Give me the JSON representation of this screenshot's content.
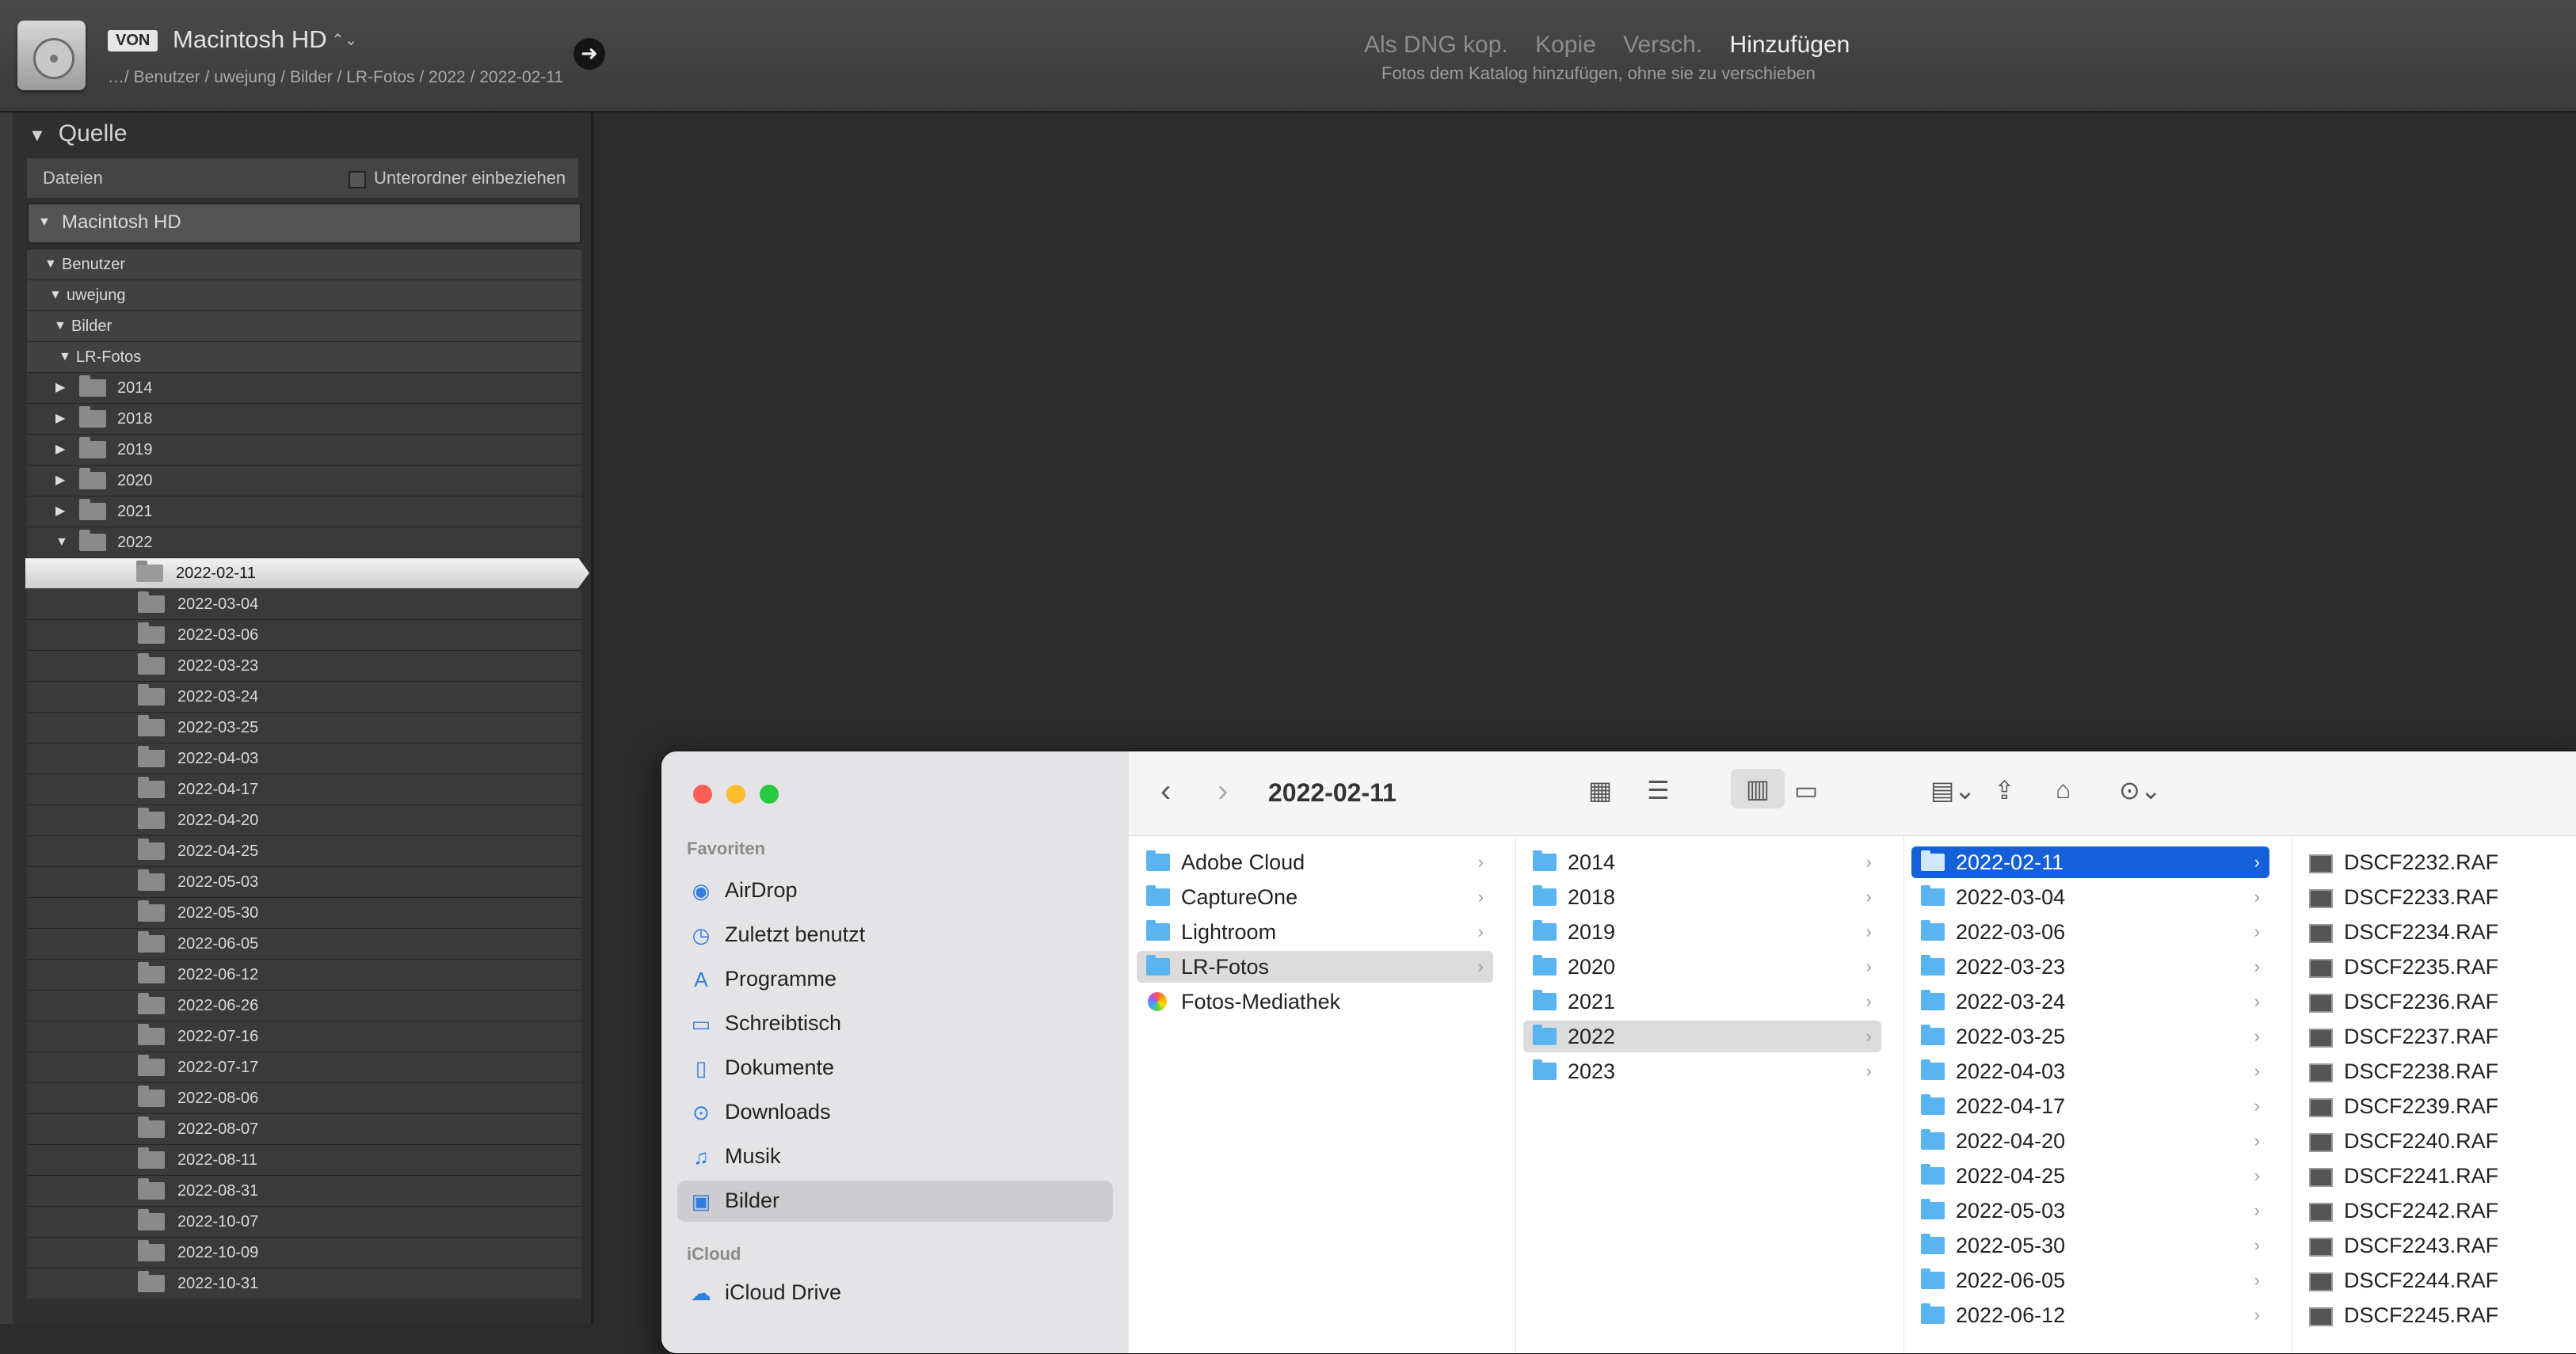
{
  "topbar": {
    "von_badge": "VON",
    "source": "Macintosh HD",
    "source_arrows": "⌃⌄",
    "breadcrumb": "…/ Benutzer / uwejung / Bilder / LR-Fotos / 2022 / 2022-02-11",
    "modes": [
      "Als DNG kop.",
      "Kopie",
      "Versch.",
      "Hinzufügen"
    ],
    "active_mode": "Hinzufügen",
    "mode_description": "Fotos dem Katalog hinzufügen, ohne sie zu verschieben"
  },
  "source_panel": {
    "title": "Quelle",
    "files_label": "Dateien",
    "subfolder_label": "Unterordner einbeziehen",
    "subfolder_checked": false,
    "volume": "Macintosh HD",
    "path": [
      "Benutzer",
      "uwejung",
      "Bilder",
      "LR-Fotos"
    ],
    "year_folders": [
      "2014",
      "2018",
      "2019",
      "2020",
      "2021",
      "2022"
    ],
    "expanded_year": "2022",
    "subfolders": [
      "2022-02-11",
      "2022-03-04",
      "2022-03-06",
      "2022-03-23",
      "2022-03-24",
      "2022-03-25",
      "2022-04-03",
      "2022-04-17",
      "2022-04-20",
      "2022-04-25",
      "2022-05-03",
      "2022-05-30",
      "2022-06-05",
      "2022-06-12",
      "2022-06-26",
      "2022-07-16",
      "2022-07-17",
      "2022-08-06",
      "2022-08-07",
      "2022-08-11",
      "2022-08-31",
      "2022-10-07",
      "2022-10-09",
      "2022-10-31"
    ],
    "selected_folder": "2022-02-11"
  },
  "finder": {
    "title": "2022-02-11",
    "sidebar": {
      "favorites_header": "Favoriten",
      "favorites": [
        {
          "label": "AirDrop",
          "icon": "airdrop-icon"
        },
        {
          "label": "Zuletzt benutzt",
          "icon": "clock-icon"
        },
        {
          "label": "Programme",
          "icon": "apps-icon"
        },
        {
          "label": "Schreibtisch",
          "icon": "desktop-icon"
        },
        {
          "label": "Dokumente",
          "icon": "document-icon"
        },
        {
          "label": "Downloads",
          "icon": "download-icon"
        },
        {
          "label": "Musik",
          "icon": "music-icon"
        },
        {
          "label": "Bilder",
          "icon": "photo-icon"
        }
      ],
      "selected": "Bilder",
      "icloud_header": "iCloud",
      "icloud": [
        {
          "label": "iCloud Drive",
          "icon": "cloud-icon"
        }
      ]
    },
    "col1": [
      "Adobe Cloud",
      "CaptureOne",
      "Lightroom",
      "LR-Fotos",
      "Fotos-Mediathek"
    ],
    "col1_selected": "LR-Fotos",
    "col2": [
      "2014",
      "2018",
      "2019",
      "2020",
      "2021",
      "2022",
      "2023"
    ],
    "col2_selected": "2022",
    "col3": [
      "2022-02-11",
      "2022-03-04",
      "2022-03-06",
      "2022-03-23",
      "2022-03-24",
      "2022-03-25",
      "2022-04-03",
      "2022-04-17",
      "2022-04-20",
      "2022-04-25",
      "2022-05-03",
      "2022-05-30",
      "2022-06-05",
      "2022-06-12"
    ],
    "col3_selected": "2022-02-11",
    "col4": [
      "DSCF2232.RAF",
      "DSCF2233.RAF",
      "DSCF2234.RAF",
      "DSCF2235.RAF",
      "DSCF2236.RAF",
      "DSCF2237.RAF",
      "DSCF2238.RAF",
      "DSCF2239.RAF",
      "DSCF2240.RAF",
      "DSCF2241.RAF",
      "DSCF2242.RAF",
      "DSCF2243.RAF",
      "DSCF2244.RAF",
      "DSCF2245.RAF"
    ]
  }
}
